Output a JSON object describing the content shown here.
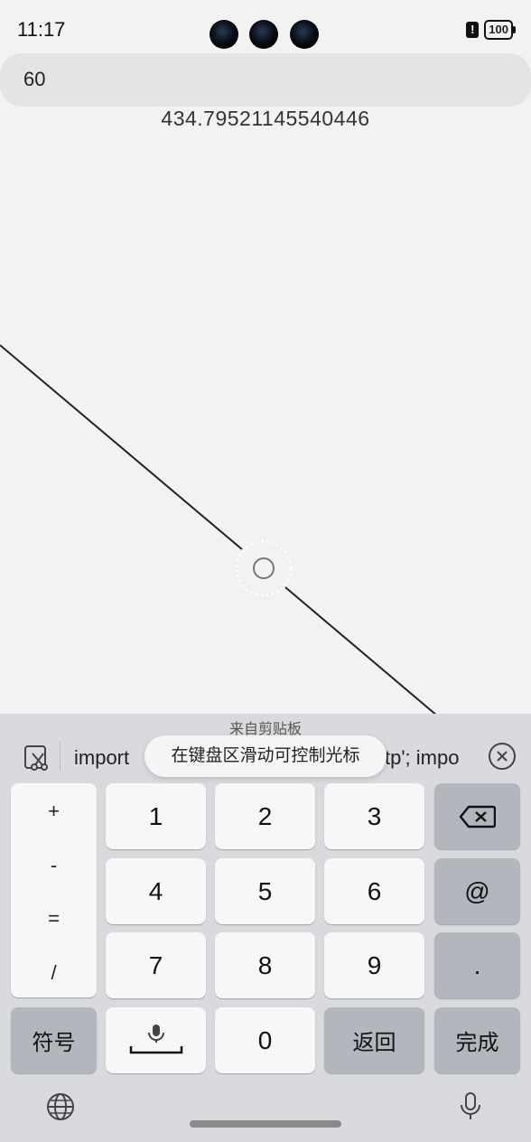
{
  "status_bar": {
    "time": "11:17",
    "battery": "100",
    "alert": "!"
  },
  "input": {
    "value": "60"
  },
  "result": "434.79521145540446",
  "keyboard": {
    "clipboard_title": "来自剪贴板",
    "clipboard_text_start": "import",
    "clipboard_text_end": "tp'; impo",
    "tooltip": "在键盘区滑动可控制光标",
    "side_symbols": [
      "+",
      "-",
      "=",
      "/"
    ],
    "digits": [
      "1",
      "2",
      "3",
      "4",
      "5",
      "6",
      "7",
      "8",
      "9",
      "0"
    ],
    "at_key": "@",
    "dot_key": ".",
    "symbols_key": "符号",
    "return_key": "返回",
    "done_key": "完成"
  }
}
